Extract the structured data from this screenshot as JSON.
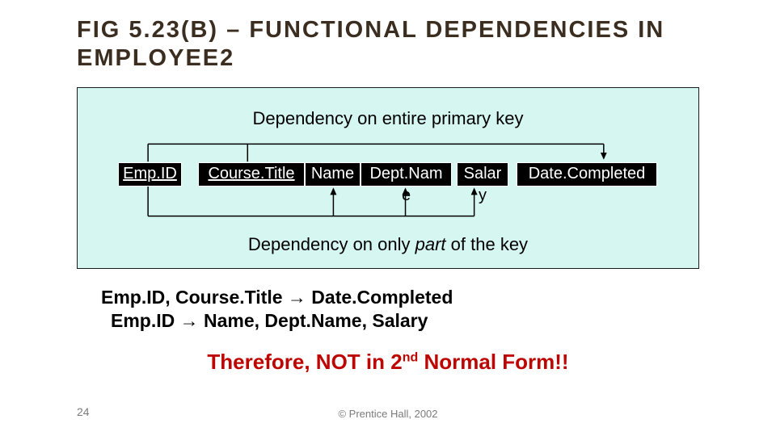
{
  "title": "FIG 5.23(B) – FUNCTIONAL DEPENDENCIES IN EMPLOYEE2",
  "diagram": {
    "top_label": "Dependency on entire primary key",
    "bottom_label_prefix": "Dependency on only ",
    "bottom_label_italic": "part",
    "bottom_label_suffix": " of the key",
    "columns": {
      "c1": "Emp.ID",
      "c2": "Course.Title",
      "c3": "Name",
      "c4": "Dept.Nam",
      "c4_overflow": "e",
      "c5": "Salar",
      "c5_overflow": "y",
      "c6": "Date.Completed"
    }
  },
  "deps": {
    "line1": "Emp.ID, Course.Title → Date.Completed",
    "line2": "Emp.ID → Name, Dept.Name, Salary"
  },
  "conclusion_prefix": "Therefore, NOT in 2",
  "conclusion_sup": "nd",
  "conclusion_suffix": " Normal Form!!",
  "page_num": "24",
  "copyright": "© Prentice Hall, 2002"
}
